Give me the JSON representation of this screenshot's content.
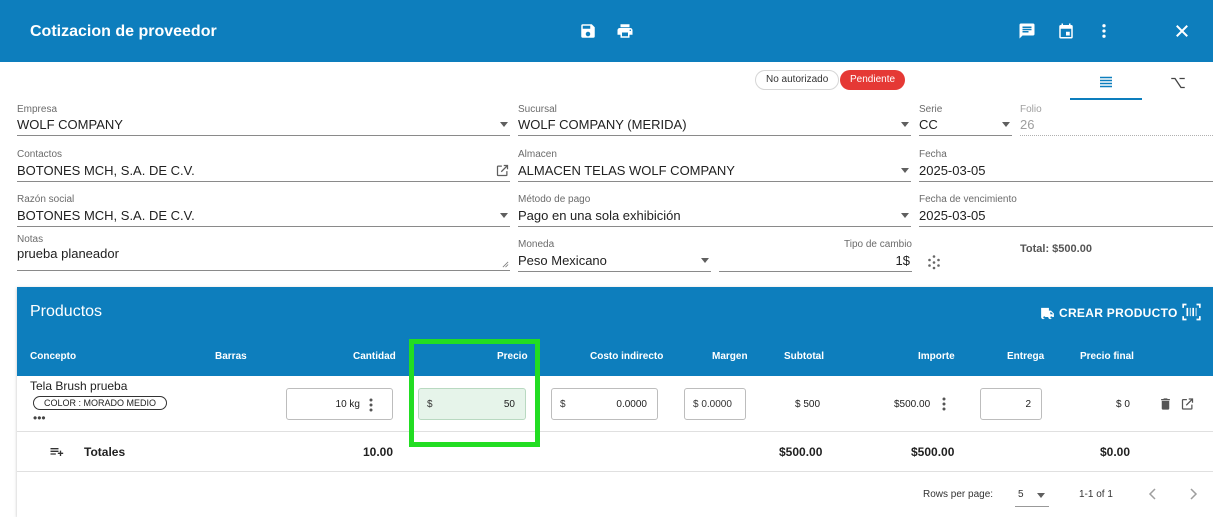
{
  "header": {
    "title": "Cotizacion de proveedor",
    "icons": [
      "save-icon",
      "print-icon",
      "comment-icon",
      "calendar-icon",
      "more-vert-icon",
      "close-icon"
    ]
  },
  "status": {
    "not_authorized": "No autorizado",
    "pending": "Pendiente",
    "pending_color": "#e53935"
  },
  "form": {
    "empresa": {
      "label": "Empresa",
      "value": "WOLF COMPANY"
    },
    "sucursal": {
      "label": "Sucursal",
      "value": "WOLF COMPANY (MERIDA)"
    },
    "serie": {
      "label": "Serie",
      "value": "CC"
    },
    "folio": {
      "label": "Folio",
      "value": "26"
    },
    "contactos": {
      "label": "Contactos",
      "value": "BOTONES MCH, S.A. DE C.V."
    },
    "almacen": {
      "label": "Almacen",
      "value": "ALMACEN TELAS WOLF COMPANY"
    },
    "fecha": {
      "label": "Fecha",
      "value": "2025-03-05"
    },
    "razon_social": {
      "label": "Razón social",
      "value": "BOTONES MCH, S.A. DE C.V."
    },
    "metodo_pago": {
      "label": "Método de pago",
      "value": "Pago en una sola exhibición"
    },
    "fecha_vencimiento": {
      "label": "Fecha de vencimiento",
      "value": "2025-03-05"
    },
    "notas": {
      "label": "Notas",
      "value": "prueba planeador"
    },
    "moneda": {
      "label": "Moneda",
      "value": "Peso Mexicano"
    },
    "tipo_cambio": {
      "label": "Tipo de cambio",
      "value": "1$"
    },
    "total": "Total: $500.00"
  },
  "products": {
    "title": "Productos",
    "create_label": "CREAR PRODUCTO",
    "columns": [
      "Concepto",
      "Barras",
      "Cantidad",
      "Precio",
      "Costo indirecto",
      "Margen",
      "Subtotal",
      "Importe",
      "Entrega",
      "Precio final"
    ],
    "row": {
      "concept": "Tela Brush prueba",
      "attribute": "COLOR : MORADO MEDIO",
      "more": "•••",
      "quantity": "10 kg",
      "price_currency": "$",
      "price": "50",
      "indirect_currency": "$",
      "indirect": "0.0000",
      "margin": "$  0.0000",
      "subtotal": "$ 500",
      "importe": "$500.00",
      "entrega": "2",
      "precio_final": "$ 0"
    },
    "totals": {
      "label": "Totales",
      "quantity": "10.00",
      "subtotal": "$500.00",
      "importe": "$500.00",
      "precio_final": "$0.00"
    },
    "pagination": {
      "rows_per_page_label": "Rows per page:",
      "rows_per_page": "5",
      "range": "1-1 of 1"
    }
  },
  "colors": {
    "primary": "#0d7ebd",
    "highlight": "#22dd22"
  }
}
